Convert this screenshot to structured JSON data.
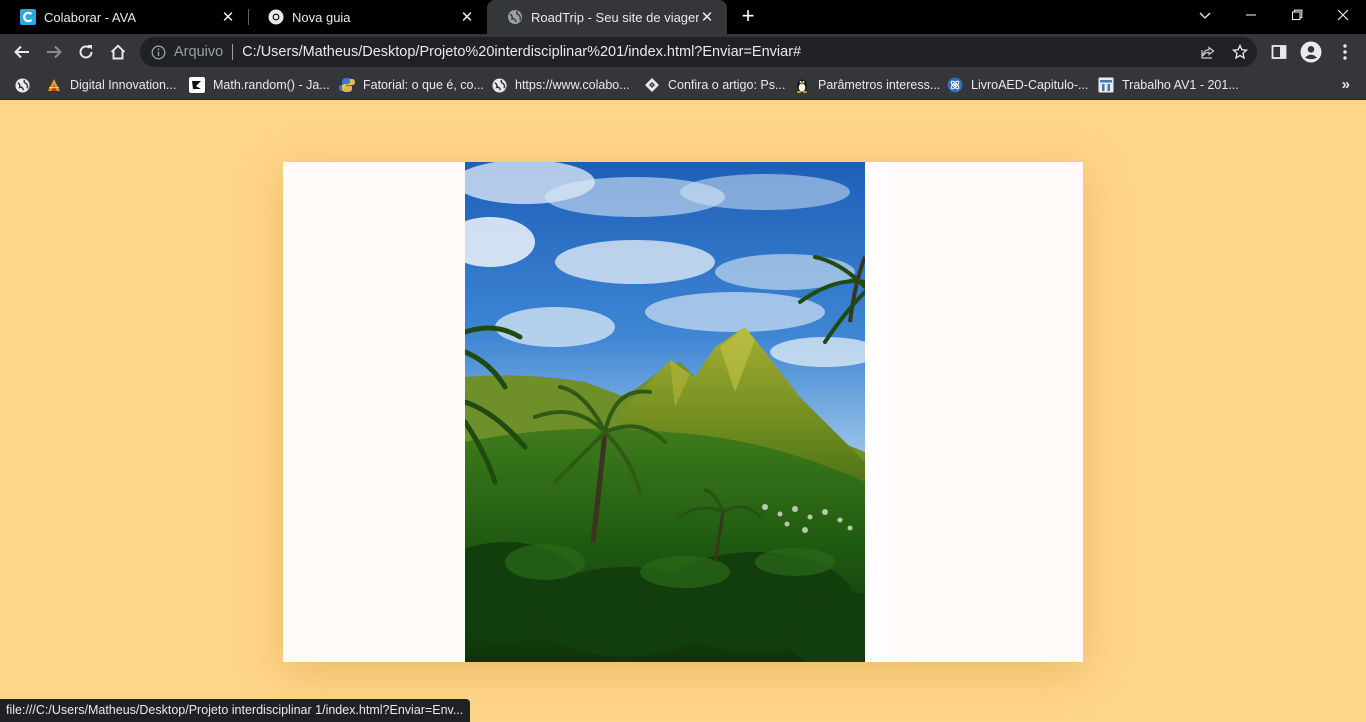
{
  "browser": {
    "tabs": [
      {
        "title": "Colaborar - AVA",
        "icon": "colaborar-c-icon",
        "active": false
      },
      {
        "title": "Nova guia",
        "icon": "chrome-icon",
        "active": false
      },
      {
        "title": "RoadTrip - Seu site de viagens",
        "icon": "globe-icon",
        "active": true
      }
    ],
    "new_tab_symbol": "+",
    "omnibox": {
      "scheme_label": "Arquivo",
      "url": "C:/Users/Matheus/Desktop/Projeto%20interdisciplinar%201/index.html?Enviar=Enviar#"
    },
    "bookmarks": [
      {
        "label": "",
        "icon": "globe-icon"
      },
      {
        "label": "Digital Innovation...",
        "icon": "dio-icon"
      },
      {
        "label": "Math.random() - Ja...",
        "icon": "dev-icon"
      },
      {
        "label": "Fatorial: o que é, co...",
        "icon": "python-icon"
      },
      {
        "label": "https://www.colabo...",
        "icon": "globe-icon"
      },
      {
        "label": "Confira o artigo: Ps...",
        "icon": "diamond-icon"
      },
      {
        "label": "Parâmetros interess...",
        "icon": "linux-tux-icon"
      },
      {
        "label": "LivroAED-Capitulo-...",
        "icon": "atom-icon"
      },
      {
        "label": "Trabalho AV1 - 201...",
        "icon": "doc-icon"
      }
    ],
    "bookmarks_overflow": "»",
    "status_text": "file:///C:/Users/Matheus/Desktop/Projeto interdisciplinar 1/index.html?Enviar=Env...",
    "colors": {
      "page_background": "#ffd589",
      "card_background": "#fff9f8",
      "chrome_dark": "#35363a",
      "tabstrip": "#000000"
    }
  },
  "page": {
    "hero_image": {
      "subject": "tropical-mountains-palm-trees"
    }
  }
}
